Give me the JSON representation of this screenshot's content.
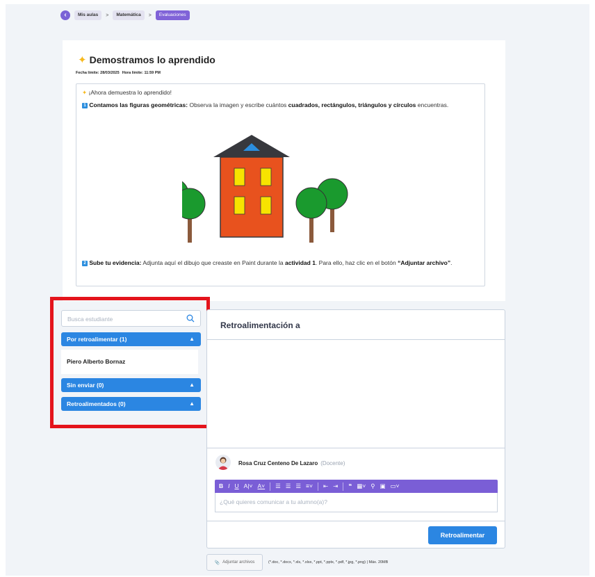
{
  "breadcrumb": {
    "items": [
      "Mis aulas",
      "Matemática",
      "Evaluaciones"
    ],
    "separator": ">"
  },
  "activity": {
    "title": "Demostramos lo aprendido",
    "due_date": "Fecha límite: 28/03/2025",
    "due_time": "Hora límite: 11:59 PM",
    "intro": "¡Ahora demuestra lo aprendido!",
    "step1": {
      "badge": "1",
      "label": "Contamos las figuras geométricas:",
      "text_a": " Observa la imagen y escribe cuántos ",
      "shapes": "cuadrados, rectángulos, triángulos y círculos",
      "text_b": " encuentras."
    },
    "step2": {
      "badge": "2",
      "label": "Sube tu evidencia:",
      "text_a": " Adjunta aquí el dibujo que creaste en Paint durante la ",
      "activity": "actividad 1",
      "text_b": ". Para ello, haz clic en el botón ",
      "button_ref": "“Adjuntar archivo”",
      "text_c": "."
    }
  },
  "sidebar": {
    "search_placeholder": "Busca estudiante",
    "groups": [
      {
        "label": "Por retroalimentar (1)",
        "expanded": true,
        "students": [
          "Piero Alberto Bornaz"
        ]
      },
      {
        "label": "Sin enviar (0)",
        "expanded": true,
        "students": []
      },
      {
        "label": "Retroalimentados (0)",
        "expanded": true,
        "students": []
      }
    ]
  },
  "feedback": {
    "title": "Retroalimentación a",
    "teacher_name": "Rosa Cruz Centeno De Lazaro",
    "teacher_role": "(Docente)",
    "editor_placeholder": "¿Qué quieres comunicar a tu alumno(a)?",
    "submit_label": "Retroalimentar",
    "toolbar": [
      "B",
      "I",
      "U",
      "A|",
      "A",
      "bullets",
      "numbered",
      "list",
      "align",
      "outdent",
      "indent",
      "quote",
      "table",
      "link",
      "image",
      "media"
    ]
  },
  "attachments": {
    "button_label": "Adjuntar archivos",
    "note": "(*.doc, *.docx, *.xls, *.xlsx, *.ppt, *.pptx, *.pdf, *.jpg, *.png) | Máx. 20MB"
  },
  "colors": {
    "accent_purple": "#7a5ed6",
    "primary_blue": "#2b86e2",
    "highlight_red": "#e4141c",
    "house_orange": "#e8521e",
    "window_yellow": "#f7e300",
    "tree_green": "#1a9a2e"
  }
}
